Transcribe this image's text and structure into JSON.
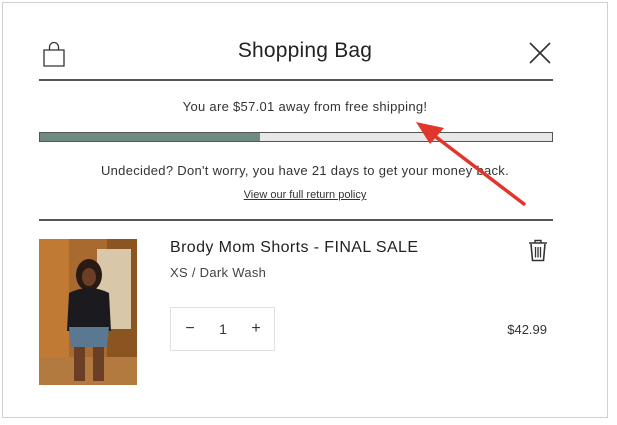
{
  "header": {
    "title": "Shopping Bag",
    "bag_icon": "shopping-bag-icon",
    "close_icon": "close-icon"
  },
  "shipping": {
    "message": "You are $57.01 away from free shipping!",
    "progress_fraction": 0.43,
    "progress_color": "#6f8b81"
  },
  "returns": {
    "message": "Undecided? Don't worry, you have 21 days to get your money back.",
    "link": "View our full return policy"
  },
  "cart": {
    "items": [
      {
        "name": "Brody Mom Shorts - FINAL SALE",
        "variant": "XS / Dark Wash",
        "quantity": "1",
        "price": "$42.99",
        "minus": "−",
        "plus": "+",
        "delete_icon": "trash-icon"
      }
    ]
  },
  "annotation": {
    "arrow_color": "#e0362c"
  }
}
